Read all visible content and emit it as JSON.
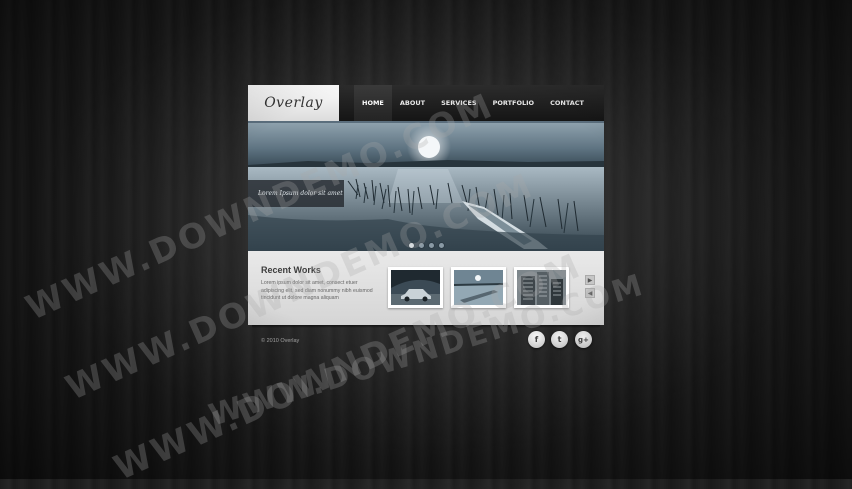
{
  "logo": {
    "text": "Overlay"
  },
  "nav": {
    "items": [
      {
        "label": "HOME",
        "active": true
      },
      {
        "label": "ABOUT",
        "active": false
      },
      {
        "label": "SERVICES",
        "active": false
      },
      {
        "label": "PORTFOLIO",
        "active": false
      },
      {
        "label": "CONTACT",
        "active": false
      }
    ]
  },
  "hero": {
    "caption": "Lorem Ipsum dolor sit amet",
    "active_slide": 1,
    "slide_count": 4
  },
  "works": {
    "title": "Recent Works",
    "description": "Lorem ipsum dolor sit amet, consect etuer adipiscing elit, sed diam nonummy nibh euismod tincidunt ut dolore magna aliquam",
    "thumbnails": [
      "car",
      "moonlit-lake",
      "buildings"
    ]
  },
  "footer": {
    "copyright": "© 2010 Overlay"
  },
  "social": [
    {
      "icon": "facebook-icon",
      "glyph": "f"
    },
    {
      "icon": "twitter-icon",
      "glyph": "t"
    },
    {
      "icon": "google-plus-icon",
      "glyph": "g+"
    }
  ],
  "watermark": {
    "text": "WWW.DOWNDEMO.COM"
  },
  "colors": {
    "accent_bar": "#5b6e7d",
    "background": "#1b1b1b",
    "header": "#151515",
    "content": "#e0e0e0"
  }
}
